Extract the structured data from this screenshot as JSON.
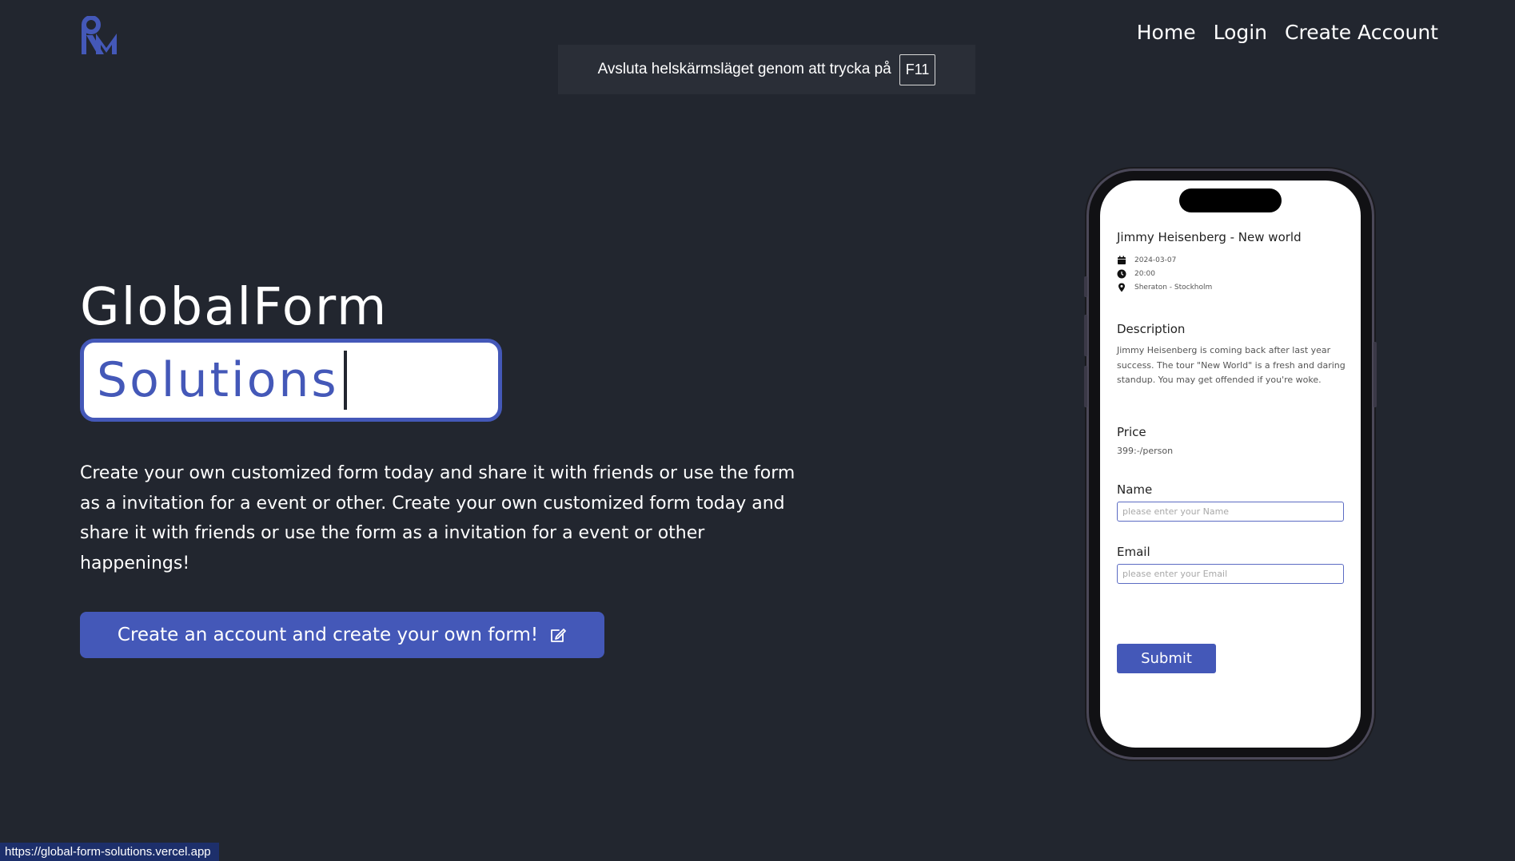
{
  "colors": {
    "background": "#22262f",
    "accent": "#4458b8",
    "text": "#ffffff"
  },
  "logo": {
    "icon": "rm-logo-icon"
  },
  "nav": {
    "items": [
      {
        "label": "Home"
      },
      {
        "label": "Login"
      },
      {
        "label": "Create Account"
      }
    ]
  },
  "fullscreen_banner": {
    "message": "Avsluta helskärmsläget genom att trycka på",
    "key": "F11"
  },
  "hero": {
    "title": "GlobalForm",
    "typed_word": "Solutions",
    "description": "Create your own customized form today and share it with friends or use the form as a invitation for a event or other. Create your own customized form today and share it with friends or use the form as a invitation for a event or other happenings!",
    "cta_label": "Create an account and create your own form!",
    "cta_icon": "edit-icon"
  },
  "phone_preview": {
    "event_title": "Jimmy Heisenberg - New world",
    "date": "2024-03-07",
    "time": "20:00",
    "location": "Sheraton - Stockholm",
    "description_label": "Description",
    "description_text": "Jimmy Heisenberg is coming back after last year success. The tour \"New World\" is a fresh and daring standup. You may get offended if you're woke.",
    "price_label": "Price",
    "price_value": "399:-/person",
    "name_label": "Name",
    "name_placeholder": "please enter your Name",
    "email_label": "Email",
    "email_placeholder": "please enter your Email",
    "submit_label": "Submit"
  },
  "status_bar": {
    "url": "https://global-form-solutions.vercel.app"
  }
}
